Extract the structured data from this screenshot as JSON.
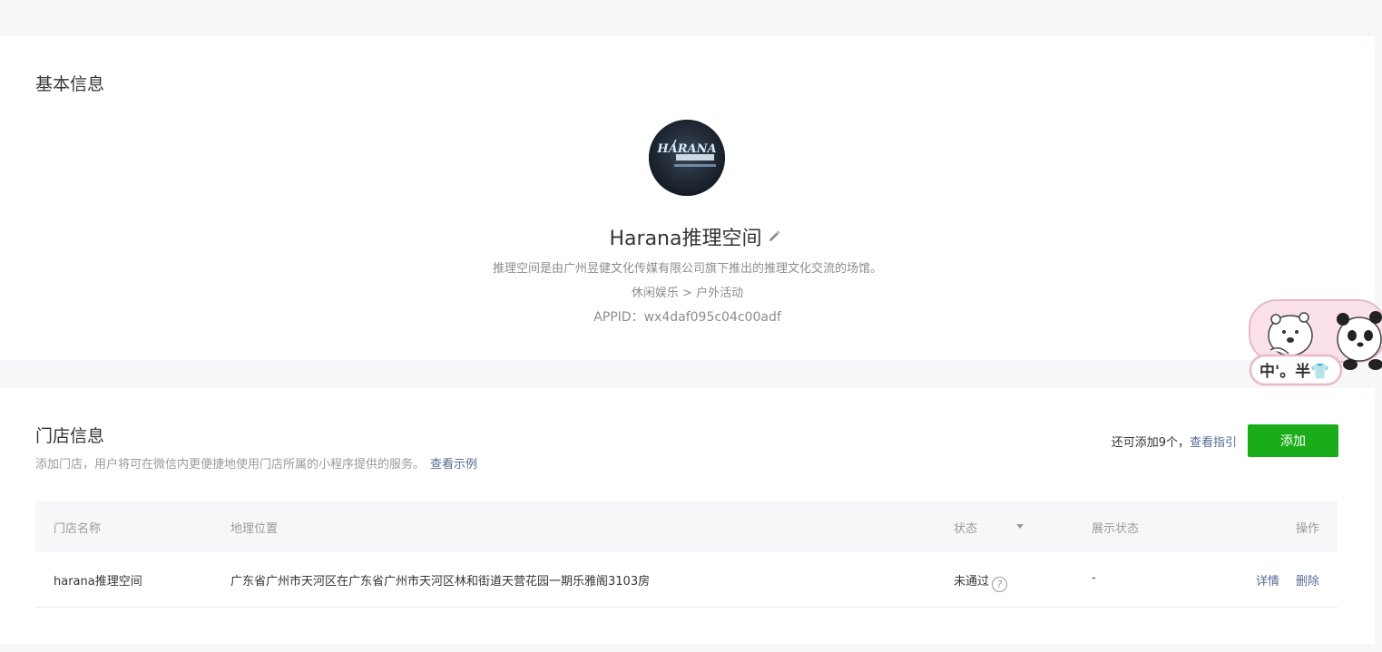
{
  "basic_info": {
    "section_title": "基本信息",
    "app_name": "Harana推理空间",
    "description": "推理空间是由广州昱健文化传媒有限公司旗下推出的推理文化交流的场馆。",
    "category": "休闲娱乐 > 户外活动",
    "appid": "APPID：wx4daf095c04c00adf",
    "avatar_text": "HARANA",
    "avatar_subtext": "哈拉娜推理空间"
  },
  "stores": {
    "section_title": "门店信息",
    "description": "添加门店，用户将可在微信内更便捷地使用门店所属的小程序提供的服务。",
    "example_link": "查看示例",
    "remaining_text": "还可添加9个，",
    "guide_link": "查看指引",
    "add_button": "添加",
    "table": {
      "headers": {
        "name": "门店名称",
        "location": "地理位置",
        "status": "状态",
        "display_status": "展示状态",
        "operations": "操作"
      },
      "rows": [
        {
          "name": "harana推理空间",
          "location": "广东省广州市天河区在广东省广州市天河区林和街道天营花园一期乐雅阁3103房",
          "status": "未通过",
          "display_status": "-",
          "op_detail": "详情",
          "op_delete": "删除"
        }
      ]
    }
  },
  "sticker": {
    "text": "中'。半👕"
  },
  "colors": {
    "primary_green": "#1aad19",
    "link_blue": "#576b95",
    "background": "#f6f7f9"
  }
}
